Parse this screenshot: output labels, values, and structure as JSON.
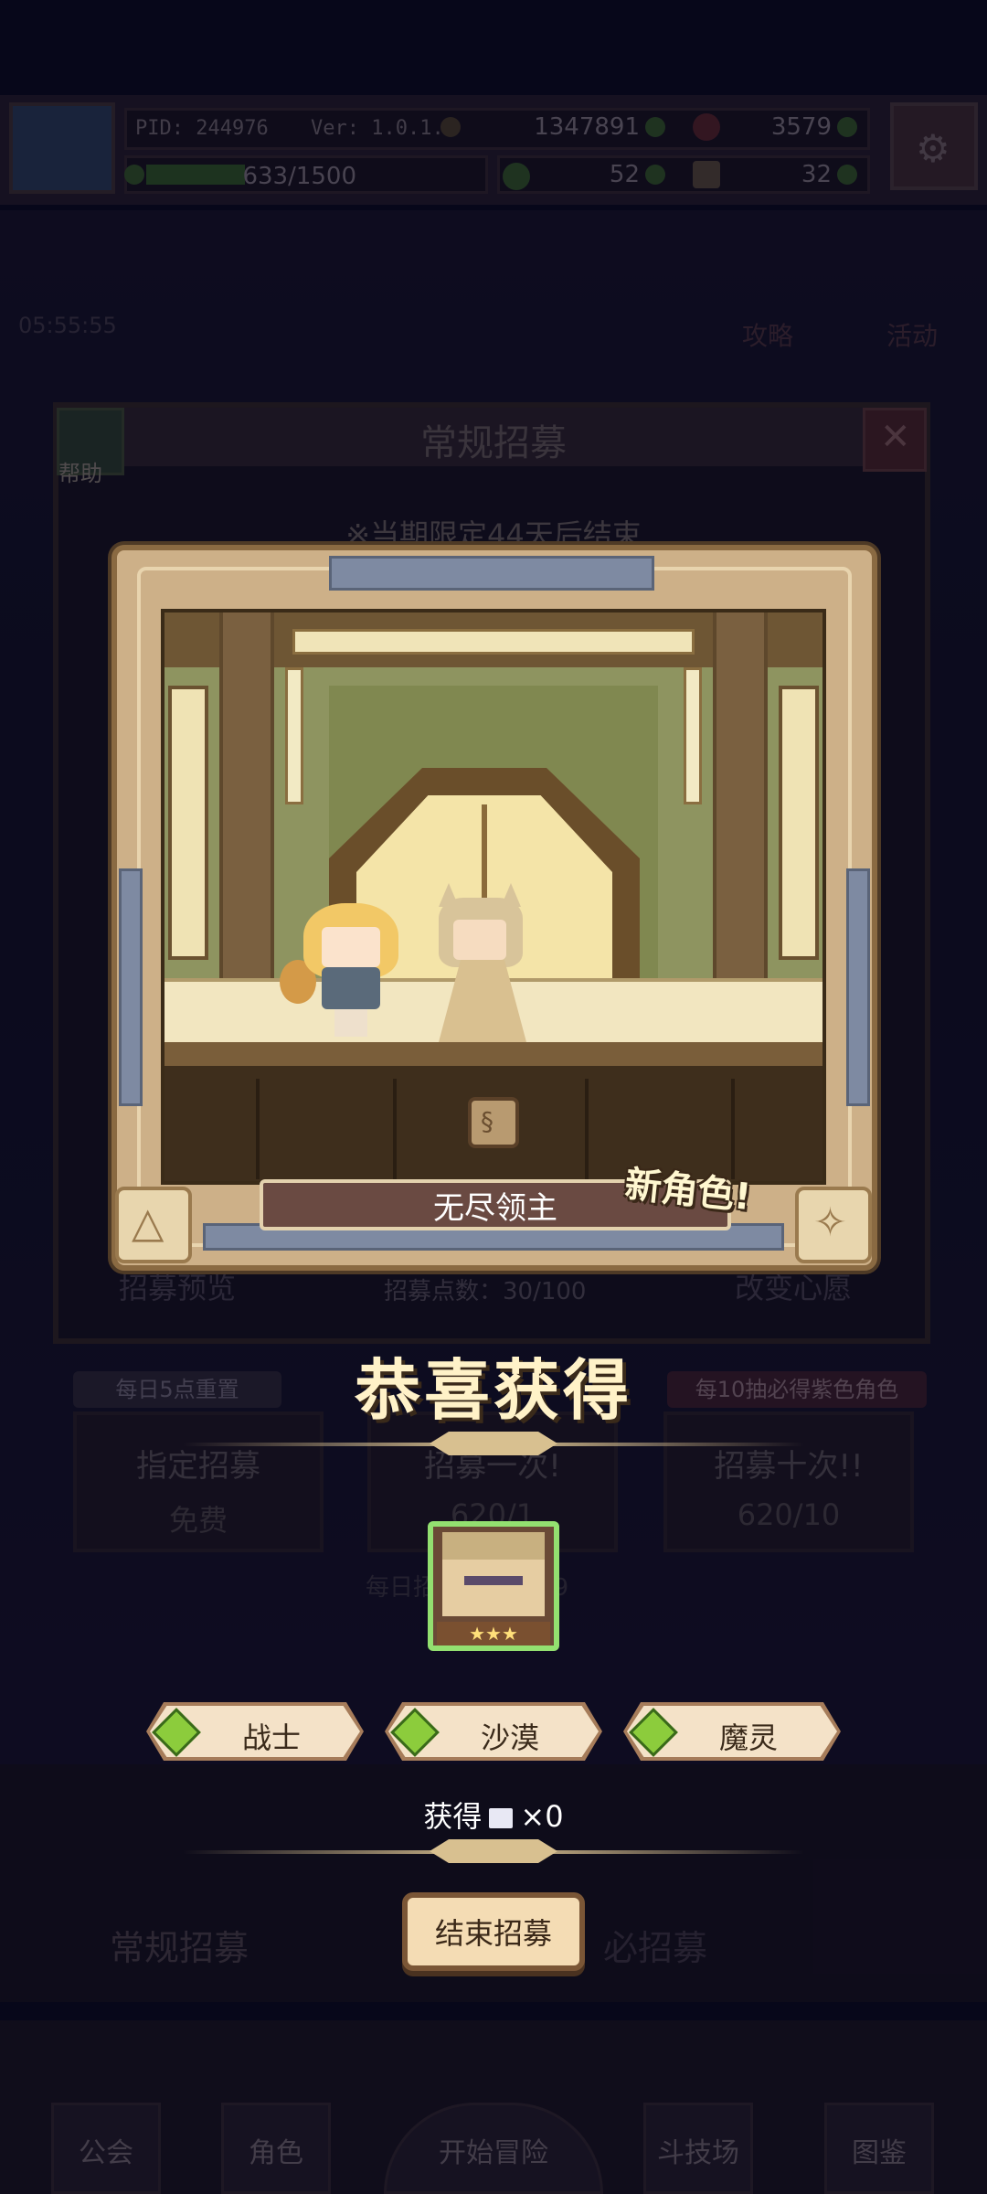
{
  "hud": {
    "pid": "PID: 244976",
    "version": "Ver: 1.0.1.0",
    "coins": "1347891",
    "rubies": "3579",
    "exp": "633/1500",
    "clovers": "52",
    "hammers": "32"
  },
  "background": {
    "timer": "05:55:55",
    "guide_label": "攻略",
    "event_label": "活动",
    "recruit_title": "常规招募",
    "help_label": "帮助",
    "limit_notice": "※当期限定44天后结束",
    "preview_label": "招募预览",
    "points_label": "招募点数：30/100",
    "wish_label": "改变心愿",
    "daily_reset": "每日5点重置",
    "guarantee": "每10抽必得紫色角色",
    "cards": [
      {
        "title": "指定招募",
        "cost": "免费"
      },
      {
        "title": "招募一次!",
        "cost": "620/1"
      },
      {
        "title": "招募十次!!",
        "cost": "620/10"
      }
    ],
    "daily_limit": "每日招募上限9999",
    "banner_left": "常规招募",
    "banner_right": "必招募"
  },
  "reveal": {
    "character_name": "无尽领主",
    "new_badge": "新角色!",
    "congrats": "恭喜获得",
    "stars": "★★★",
    "tags": [
      "战士",
      "沙漠",
      "魔灵"
    ],
    "obtain_label": "获得",
    "obtain_count": "×0",
    "end_button": "结束招募"
  },
  "nav": {
    "items": [
      "公会",
      "角色",
      "开始冒险",
      "斗技场",
      "图鉴"
    ]
  }
}
